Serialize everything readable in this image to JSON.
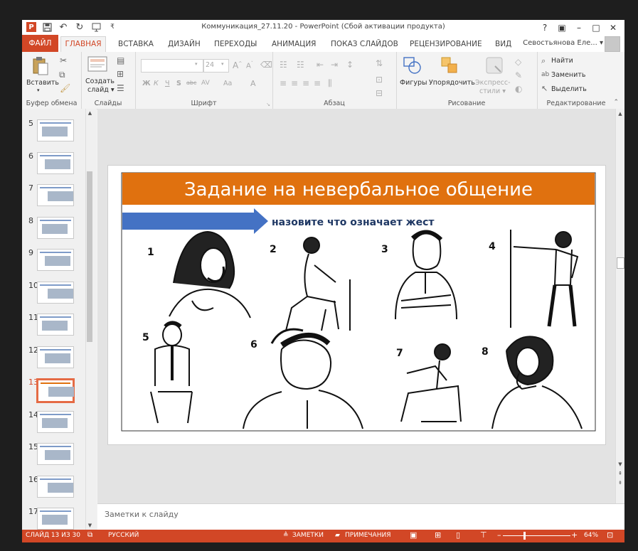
{
  "window": {
    "title": "Коммуникация_27.11.20 - PowerPoint (Сбой активации продукта)",
    "controls": {
      "help": "?",
      "restore_ribbon": "▣",
      "minimize": "–",
      "maximize": "□",
      "close": "✕"
    }
  },
  "tabs": [
    {
      "label": "ФАЙЛ"
    },
    {
      "label": "ГЛАВНАЯ"
    },
    {
      "label": "ВСТАВКА"
    },
    {
      "label": "ДИЗАЙН"
    },
    {
      "label": "ПЕРЕХОДЫ"
    },
    {
      "label": "АНИМАЦИЯ"
    },
    {
      "label": "ПОКАЗ СЛАЙДОВ"
    },
    {
      "label": "РЕЦЕНЗИРОВАНИЕ"
    },
    {
      "label": "ВИД"
    }
  ],
  "user": "Севостьянова Еле... ▾",
  "ribbon": {
    "clipboard": {
      "label": "Буфер обмена",
      "paste": "Вставить"
    },
    "slides": {
      "label": "Слайды",
      "new_slide_1": "Создать",
      "new_slide_2": "слайд ▾"
    },
    "font": {
      "label": "Шрифт",
      "size": "24",
      "bold": "Ж",
      "italic": "К",
      "underline": "Ч",
      "shadow": "S",
      "strike": "abc",
      "spacing": "AV",
      "case": "Aa",
      "color": "A"
    },
    "paragraph": {
      "label": "Абзац"
    },
    "drawing": {
      "label": "Рисование",
      "shapes": "Фигуры",
      "arrange": "Упорядочить",
      "quick_styles_1": "Экспресс-",
      "quick_styles_2": "стили ▾"
    },
    "editing": {
      "label": "Редактирование",
      "find": "Найти",
      "replace": "Заменить",
      "select": "Выделить"
    }
  },
  "thumbnails": [
    {
      "num": "5"
    },
    {
      "num": "6"
    },
    {
      "num": "7"
    },
    {
      "num": "8"
    },
    {
      "num": "9"
    },
    {
      "num": "10"
    },
    {
      "num": "11"
    },
    {
      "num": "12"
    },
    {
      "num": "13",
      "selected": true
    },
    {
      "num": "14"
    },
    {
      "num": "15"
    },
    {
      "num": "16"
    },
    {
      "num": "17"
    }
  ],
  "slide": {
    "title": "Задание на невербальное общение",
    "arrow_text": "назовите что означает жест",
    "figures": [
      "1",
      "2",
      "3",
      "4",
      "5",
      "6",
      "7",
      "8"
    ],
    "title_color": "#e0710f",
    "arrow_color": "#4472c4"
  },
  "notes_placeholder": "Заметки к слайду",
  "status": {
    "slide_info": "СЛАЙД 13 ИЗ 30",
    "language": "РУССКИЙ",
    "notes": "ЗАМЕТКИ",
    "comments": "ПРИМЕЧАНИЯ",
    "zoom": "64%"
  },
  "colors": {
    "accent": "#d24726"
  }
}
